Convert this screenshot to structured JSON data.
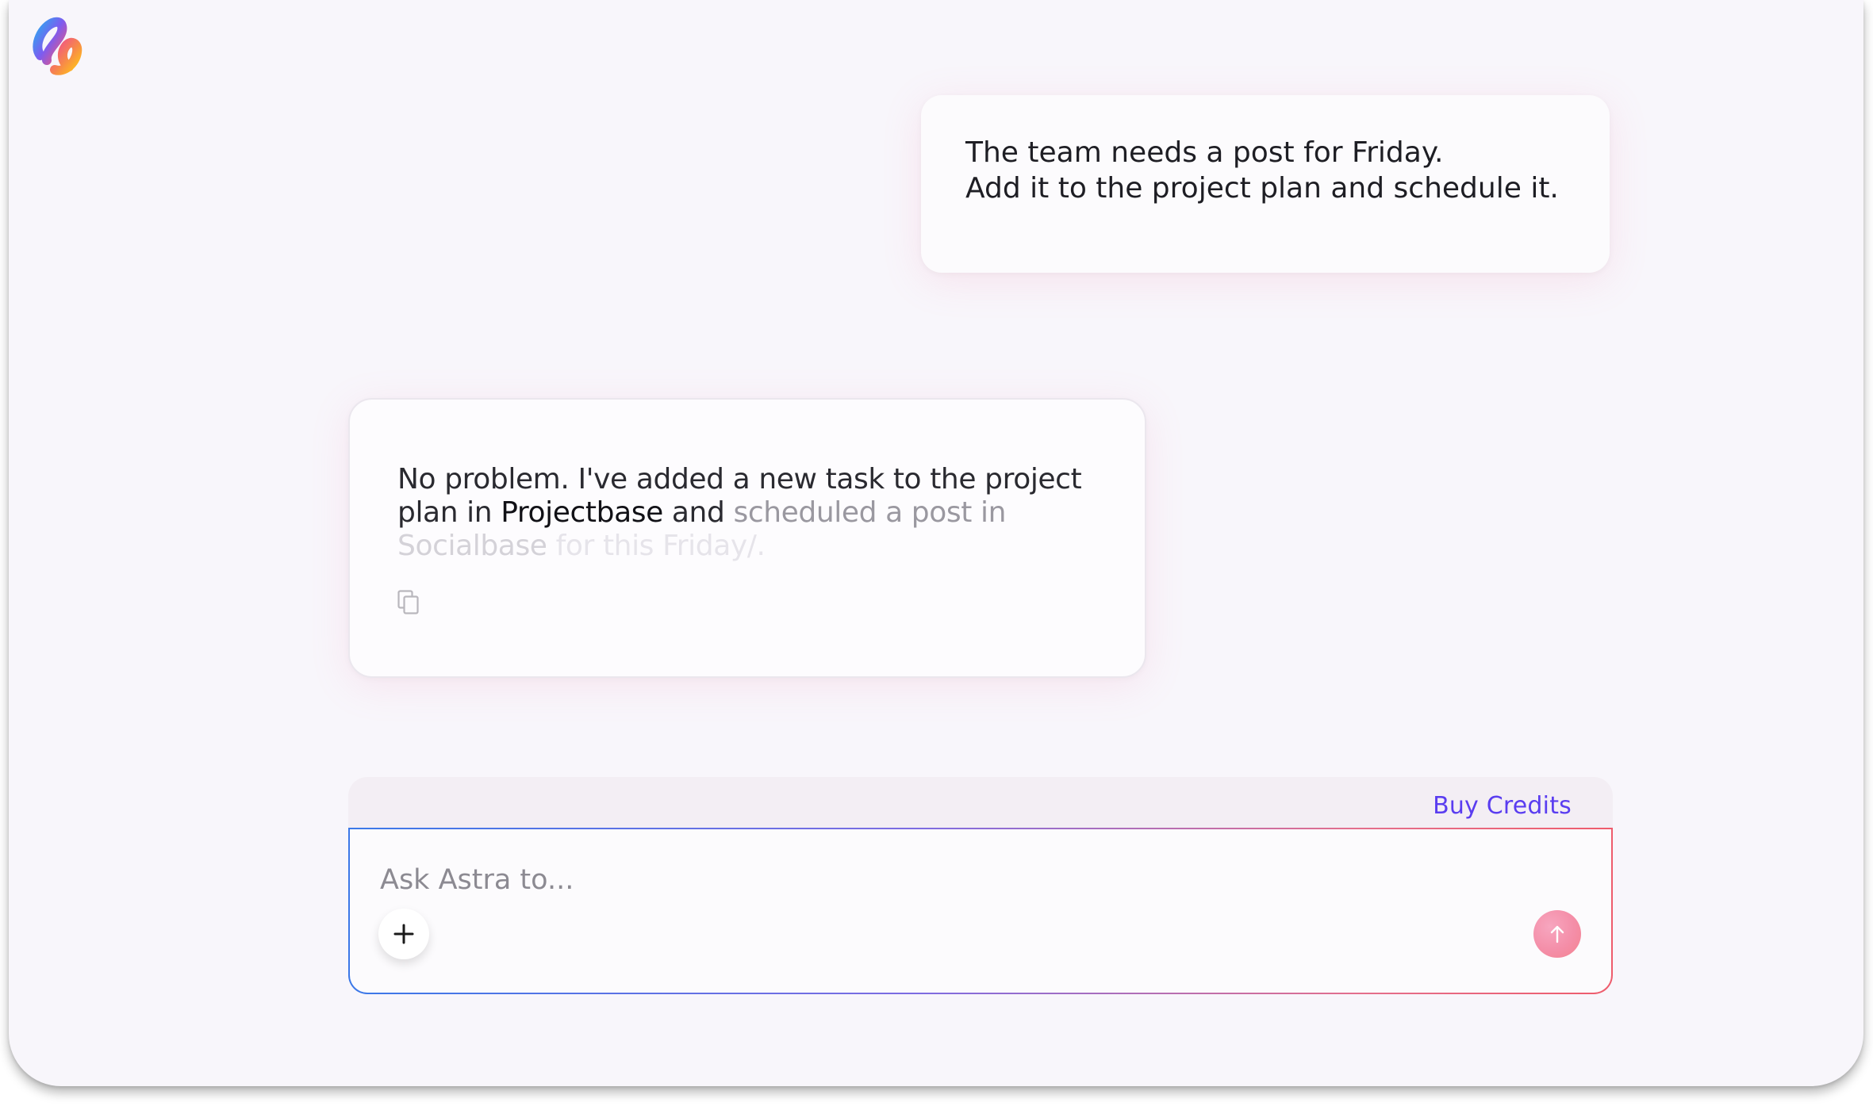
{
  "chat": {
    "user_message": {
      "lines": [
        "The team needs a post for Friday.",
        "Add it to the project plan and schedule it."
      ]
    },
    "assistant_message": {
      "segments": [
        "No problem. I've added a new task to the project plan in ",
        "Projectbase",
        " and ",
        "scheduled a post in ",
        "Socialbase",
        " for this Friday/."
      ],
      "copy_icon": "copy-icon"
    }
  },
  "composer": {
    "buy_credits_label": "Buy Credits",
    "input_placeholder": "Ask Astra to...",
    "input_value": "",
    "add_icon": "plus-icon",
    "send_icon": "arrow-up-icon"
  },
  "colors": {
    "accent": "#5a3df0",
    "gradient_start": "#3b78e8",
    "gradient_end": "#ee5c6c",
    "send_button": "#f48ea8"
  }
}
